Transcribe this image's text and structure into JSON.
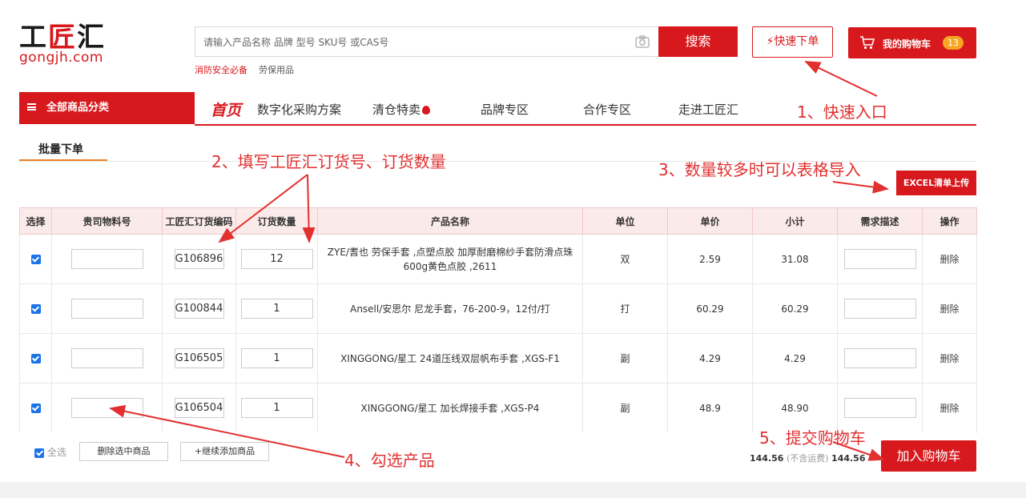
{
  "header": {
    "logo_cn_black": "工",
    "logo_cn_red": "匠",
    "logo_cn_black2": "汇",
    "logo_en": "gongjh.com",
    "search_placeholder": "请输入产品名称 品牌 型号 SKU号 或CAS号",
    "search_button": "搜索",
    "hot_link_1": "消防安全必备",
    "hot_link_2": "劳保用品",
    "quick_order": "快速下单",
    "cart_label": "我的购物车",
    "cart_count": "13",
    "accent_color": "#d7191d"
  },
  "nav": {
    "all_categories": "全部商品分类",
    "home": "首页",
    "items": [
      "数字化采购方案",
      "清仓特卖",
      "品牌专区",
      "合作专区",
      "走进工匠汇"
    ]
  },
  "batch": {
    "tab_label": "批量下单",
    "excel_button": "EXCEL清单上传"
  },
  "table": {
    "headers": [
      "选择",
      "贵司物料号",
      "工匠汇订货编码",
      "订货数量",
      "产品名称",
      "单位",
      "单价",
      "小计",
      "需求描述",
      "操作"
    ],
    "rows": [
      {
        "code": "G106896",
        "qty": "12",
        "name": "ZYE/耆也 劳保手套 ,点塑点胶 加厚耐磨棉纱手套防滑点珠 600g黄色点胶 ,2611",
        "unit": "双",
        "price": "2.59",
        "subtotal": "31.08",
        "action": "删除"
      },
      {
        "code": "G100844",
        "qty": "1",
        "name": "Ansell/安思尔 尼龙手套，76-200-9，12付/打",
        "unit": "打",
        "price": "60.29",
        "subtotal": "60.29",
        "action": "删除"
      },
      {
        "code": "G106505",
        "qty": "1",
        "name": "XINGGONG/星工 24道压线双层帆布手套 ,XGS-F1",
        "unit": "副",
        "price": "4.29",
        "subtotal": "4.29",
        "action": "删除"
      },
      {
        "code": "G106504",
        "qty": "1",
        "name": "XINGGONG/星工 加长焊接手套 ,XGS-P4",
        "unit": "副",
        "price": "48.9",
        "subtotal": "48.90",
        "action": "删除"
      }
    ]
  },
  "footer": {
    "select_all": "全选",
    "delete_selected": "删除选中商品",
    "add_more": "+继续添加商品",
    "total": "144.56",
    "shipping_note": "(不含运费)",
    "grand_total": "144.56",
    "add_to_cart": "加入购物车"
  },
  "annotations": {
    "a1": "1、快速入口",
    "a2": "2、填写工匠汇订货号、订货数量",
    "a3": "3、数量较多时可以表格导入",
    "a4": "4、勾选产品",
    "a5": "5、提交购物车"
  }
}
